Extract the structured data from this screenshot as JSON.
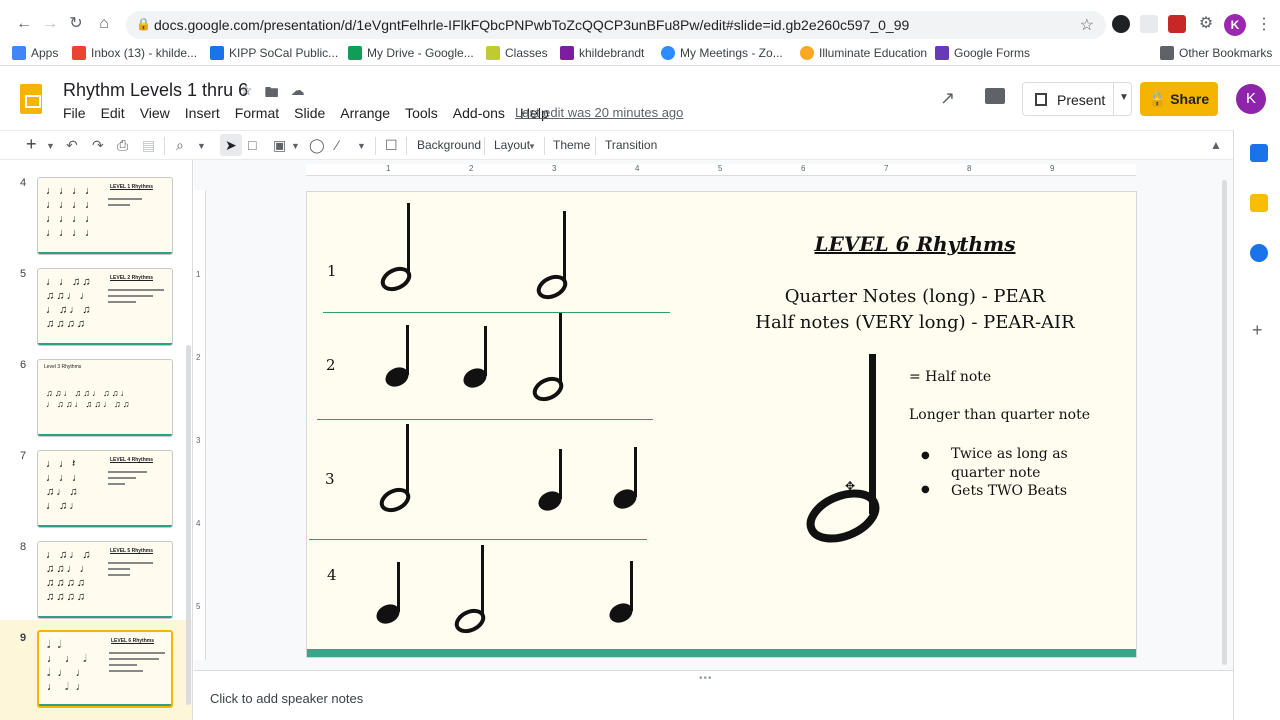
{
  "browser": {
    "url": "docs.google.com/presentation/d/1eVgntFelhrle-IFlkFQbcPNPwbToZcQQCP3unBFu8Pw/edit#slide=id.gb2e260c597_0_99",
    "bookmarks": [
      {
        "label": "Apps"
      },
      {
        "label": "Inbox (13) - khilde..."
      },
      {
        "label": "KIPP SoCal Public..."
      },
      {
        "label": "My Drive - Google..."
      },
      {
        "label": "Classes"
      },
      {
        "label": "khildebrandt"
      },
      {
        "label": "My Meetings - Zo..."
      },
      {
        "label": "Illuminate Education"
      },
      {
        "label": "Google Forms"
      },
      {
        "label": "Other Bookmarks"
      }
    ],
    "avatar_letter": "K"
  },
  "app": {
    "doc_title": "Rhythm Levels 1 thru 6",
    "menus": [
      "File",
      "Edit",
      "View",
      "Insert",
      "Format",
      "Slide",
      "Arrange",
      "Tools",
      "Add-ons",
      "Help"
    ],
    "last_edit": "Last edit was 20 minutes ago",
    "present_label": "Present",
    "share_label": "Share",
    "avatar_letter": "K"
  },
  "toolbar": {
    "background": "Background",
    "layout": "Layout",
    "theme": "Theme",
    "transition": "Transition"
  },
  "filmstrip": {
    "slides": [
      {
        "num": "4",
        "title": "LEVEL 1 Rhythms"
      },
      {
        "num": "5",
        "title": "LEVEL 2 Rhythms"
      },
      {
        "num": "6",
        "title": "Level 3 Rhythms"
      },
      {
        "num": "7",
        "title": "LEVEL 4 Rhythms"
      },
      {
        "num": "8",
        "title": "LEVEL 5 Rhythms"
      },
      {
        "num": "9",
        "title": "LEVEL 6 Rhythms"
      }
    ]
  },
  "ruler": {
    "h": [
      "1",
      "2",
      "3",
      "4",
      "5",
      "6",
      "7",
      "8",
      "9"
    ],
    "v": [
      "1",
      "2",
      "3",
      "4",
      "5"
    ]
  },
  "slide": {
    "title": "LEVEL 6 Rhythms",
    "line1": "Quarter Notes (long) - PEAR",
    "line2": "Half notes (VERY long) - PEAR-AIR",
    "def": "= Half note",
    "longer": "Longer than quarter note",
    "bullet1": "Twice as long as quarter note",
    "bullet2": "Gets TWO Beats",
    "rows": [
      "1",
      "2",
      "3",
      "4"
    ]
  },
  "notes": {
    "placeholder": "Click to add speaker notes"
  },
  "colors": {
    "accent": "#f4b400",
    "slide_bg": "#fffdf0",
    "footer_bar": "#3aa58a"
  }
}
